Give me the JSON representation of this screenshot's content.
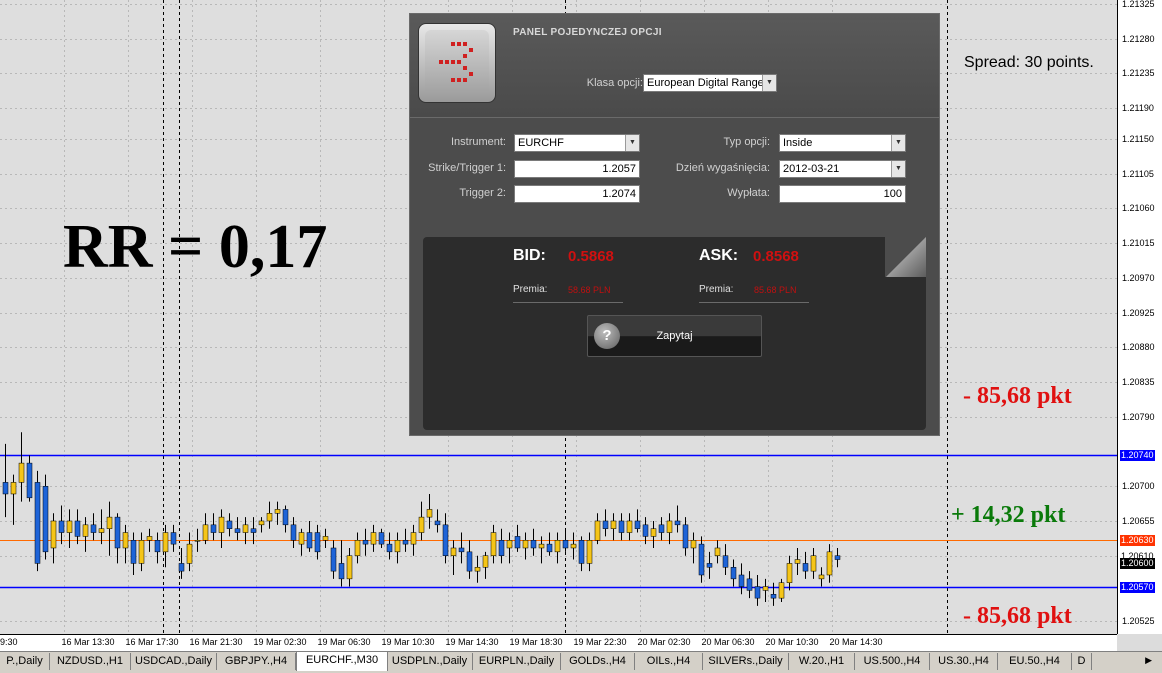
{
  "chart": {
    "symbol_tab": "EURCHF.,M30",
    "colors": {
      "background": "#dedede",
      "bull": "#f5c518",
      "bear": "#1e64d8",
      "wick": "#000000",
      "trigger_line": "#0000ff",
      "market_line": "#ff6a00"
    },
    "price_scale": {
      "max": 1.21325,
      "min": 1.20515
    },
    "price_labels": [
      "1.21325",
      "1.21280",
      "1.21235",
      "1.21190",
      "1.21150",
      "1.21105",
      "1.21060",
      "1.21015",
      "1.20970",
      "1.20925",
      "1.20880",
      "1.20835",
      "1.20790",
      "1.20700",
      "1.20655",
      "1.20610",
      "1.20525"
    ],
    "marked_prices": [
      {
        "value": "1.20740",
        "bg": "#0000ff",
        "fg": "#ffffff"
      },
      {
        "value": "1.20630",
        "bg": "#ff3300",
        "fg": "#ffffff"
      },
      {
        "value": "1.20610",
        "bg": "#ffffff",
        "fg": "#000000"
      },
      {
        "value": "1.20600",
        "bg": "#000000",
        "fg": "#ffffff"
      },
      {
        "value": "1.20570",
        "bg": "#0000ff",
        "fg": "#ffffff"
      }
    ],
    "time_labels": [
      "9:30",
      "16 Mar 13:30",
      "16 Mar 17:30",
      "16 Mar 21:30",
      "19 Mar 02:30",
      "19 Mar 06:30",
      "19 Mar 10:30",
      "19 Mar 14:30",
      "19 Mar 18:30",
      "19 Mar 22:30",
      "20 Mar 02:30",
      "20 Mar 06:30",
      "20 Mar 10:30",
      "20 Mar 14:30"
    ],
    "annotations": {
      "rr": "RR = 0,17",
      "spread": "Spread: 30 points.",
      "loss_top": "- 85,68 pkt",
      "gain": "+ 14,32 pkt",
      "loss_bottom": "- 85,68 pkt"
    }
  },
  "panel": {
    "title": "PANEL POJEDYNCZEJ OPCJI",
    "class_label": "Klasa opcji:",
    "class_value": "European Digital Range",
    "instrument_label": "Instrument:",
    "instrument_value": "EURCHF",
    "strike_label": "Strike/Trigger 1:",
    "strike_value": "1.2057",
    "trigger2_label": "Trigger 2:",
    "trigger2_value": "1.2074",
    "type_label": "Typ opcji:",
    "type_value": "Inside",
    "expiry_label": "Dzień wygaśnięcia:",
    "expiry_value": "2012-03-21",
    "payout_label": "Wypłata:",
    "payout_value": "100",
    "bid_label": "BID:",
    "bid_value": "0.5868",
    "ask_label": "ASK:",
    "ask_value": "0.8568",
    "premia_label": "Premia:",
    "bid_premia": "58.68 PLN",
    "ask_premia": "85.68 PLN",
    "button_label": "Zapytaj",
    "help_icon": "question-mark-icon"
  },
  "tabs": [
    "P.,Daily",
    "NZDUSD.,H1",
    "USDCAD.,Daily",
    "GBPJPY.,H4",
    "EURCHF.,M30",
    "USDPLN.,Daily",
    "EURPLN.,Daily",
    "GOLDs.,H4",
    "OILs.,H4",
    "SILVERs.,Daily",
    "W.20.,H1",
    "US.500.,H4",
    "US.30.,H4",
    "EU.50.,H4",
    "D"
  ],
  "active_tab": "EURCHF.,M30",
  "candles": [
    [
      1.20705,
      1.20755,
      1.2066,
      1.2069
    ],
    [
      1.2069,
      1.20715,
      1.2065,
      1.20705
    ],
    [
      1.20705,
      1.2077,
      1.2068,
      1.2073
    ],
    [
      1.2073,
      1.2074,
      1.2068,
      1.20685
    ],
    [
      1.20705,
      1.2072,
      1.2059,
      1.206
    ],
    [
      1.207,
      1.20715,
      1.20605,
      1.20615
    ],
    [
      1.2062,
      1.20665,
      1.206,
      1.20655
    ],
    [
      1.20655,
      1.20675,
      1.20625,
      1.2064
    ],
    [
      1.2064,
      1.2067,
      1.2062,
      1.20655
    ],
    [
      1.20655,
      1.2067,
      1.20625,
      1.20635
    ],
    [
      1.20635,
      1.2066,
      1.20615,
      1.2065
    ],
    [
      1.2065,
      1.20665,
      1.2063,
      1.2064
    ],
    [
      1.2064,
      1.2067,
      1.20625,
      1.20645
    ],
    [
      1.20645,
      1.2068,
      1.2061,
      1.2066
    ],
    [
      1.2066,
      1.20665,
      1.206,
      1.2062
    ],
    [
      1.2062,
      1.2065,
      1.206,
      1.2064
    ],
    [
      1.2063,
      1.2064,
      1.20585,
      1.206
    ],
    [
      1.206,
      1.2064,
      1.2059,
      1.2063
    ],
    [
      1.2063,
      1.20645,
      1.20615,
      1.20635
    ],
    [
      1.2063,
      1.2064,
      1.206,
      1.20615
    ],
    [
      1.20615,
      1.2065,
      1.20595,
      1.2064
    ],
    [
      1.2064,
      1.2065,
      1.20615,
      1.20625
    ],
    [
      1.206,
      1.2062,
      1.2058,
      1.2059
    ],
    [
      1.206,
      1.2064,
      1.2059,
      1.20625
    ],
    [
      1.2063,
      1.20645,
      1.20615,
      1.2063
    ],
    [
      1.2063,
      1.20665,
      1.20625,
      1.2065
    ],
    [
      1.2065,
      1.20665,
      1.2063,
      1.2064
    ],
    [
      1.2064,
      1.2067,
      1.2062,
      1.2066
    ],
    [
      1.20655,
      1.20665,
      1.20635,
      1.20645
    ],
    [
      1.20645,
      1.2066,
      1.2063,
      1.2064
    ],
    [
      1.2064,
      1.2066,
      1.20625,
      1.2065
    ],
    [
      1.20645,
      1.2066,
      1.20625,
      1.2064
    ],
    [
      1.2065,
      1.2066,
      1.2064,
      1.20655
    ],
    [
      1.20655,
      1.2068,
      1.20645,
      1.20665
    ],
    [
      1.20665,
      1.2068,
      1.2065,
      1.2067
    ],
    [
      1.2067,
      1.20675,
      1.2064,
      1.2065
    ],
    [
      1.2065,
      1.2066,
      1.2062,
      1.2063
    ],
    [
      1.20625,
      1.20645,
      1.2061,
      1.2064
    ],
    [
      1.2064,
      1.20655,
      1.20615,
      1.2062
    ],
    [
      1.2064,
      1.2065,
      1.20605,
      1.20615
    ],
    [
      1.2063,
      1.20645,
      1.2062,
      1.20635
    ],
    [
      1.2062,
      1.2063,
      1.2058,
      1.2059
    ],
    [
      1.206,
      1.2063,
      1.2057,
      1.2058
    ],
    [
      1.2058,
      1.2062,
      1.2057,
      1.2061
    ],
    [
      1.2061,
      1.2064,
      1.206,
      1.2063
    ],
    [
      1.2063,
      1.20645,
      1.2061,
      1.20625
    ],
    [
      1.20625,
      1.2065,
      1.20615,
      1.2064
    ],
    [
      1.2064,
      1.20645,
      1.2062,
      1.20625
    ],
    [
      1.20625,
      1.2064,
      1.20605,
      1.20615
    ],
    [
      1.20615,
      1.2064,
      1.206,
      1.2063
    ],
    [
      1.2063,
      1.20645,
      1.20615,
      1.20625
    ],
    [
      1.20625,
      1.2065,
      1.2061,
      1.2064
    ],
    [
      1.2064,
      1.2068,
      1.2063,
      1.2066
    ],
    [
      1.2066,
      1.2069,
      1.20645,
      1.2067
    ],
    [
      1.20655,
      1.2067,
      1.2064,
      1.2065
    ],
    [
      1.2065,
      1.20665,
      1.206,
      1.2061
    ],
    [
      1.2061,
      1.2063,
      1.20585,
      1.2062
    ],
    [
      1.2062,
      1.2064,
      1.206,
      1.20615
    ],
    [
      1.20615,
      1.2063,
      1.2058,
      1.2059
    ],
    [
      1.2059,
      1.2061,
      1.20575,
      1.20595
    ],
    [
      1.20595,
      1.20615,
      1.2058,
      1.2061
    ],
    [
      1.2061,
      1.2065,
      1.206,
      1.2064
    ],
    [
      1.2063,
      1.20645,
      1.206,
      1.2061
    ],
    [
      1.2062,
      1.2064,
      1.206,
      1.2063
    ],
    [
      1.20635,
      1.2065,
      1.20615,
      1.2062
    ],
    [
      1.2062,
      1.2064,
      1.20605,
      1.2063
    ],
    [
      1.2063,
      1.20645,
      1.2061,
      1.2062
    ],
    [
      1.2062,
      1.20635,
      1.206,
      1.20625
    ],
    [
      1.20625,
      1.2064,
      1.2061,
      1.20615
    ],
    [
      1.20615,
      1.2064,
      1.206,
      1.2063
    ],
    [
      1.2063,
      1.20645,
      1.20615,
      1.2062
    ],
    [
      1.2062,
      1.2064,
      1.20605,
      1.20625
    ],
    [
      1.2063,
      1.20635,
      1.2059,
      1.206
    ],
    [
      1.206,
      1.2064,
      1.2059,
      1.2063
    ],
    [
      1.2063,
      1.20665,
      1.20625,
      1.20655
    ],
    [
      1.20655,
      1.2067,
      1.20635,
      1.20645
    ],
    [
      1.20645,
      1.20665,
      1.2063,
      1.20655
    ],
    [
      1.20655,
      1.20665,
      1.2063,
      1.2064
    ],
    [
      1.2064,
      1.20665,
      1.2063,
      1.20655
    ],
    [
      1.20655,
      1.2067,
      1.2064,
      1.20645
    ],
    [
      1.2065,
      1.2066,
      1.20625,
      1.20635
    ],
    [
      1.20635,
      1.20655,
      1.2062,
      1.20645
    ],
    [
      1.2065,
      1.2066,
      1.2063,
      1.2064
    ],
    [
      1.2064,
      1.20665,
      1.20625,
      1.20655
    ],
    [
      1.20655,
      1.20675,
      1.2064,
      1.2065
    ],
    [
      1.2065,
      1.2066,
      1.2061,
      1.2062
    ],
    [
      1.2062,
      1.2064,
      1.206,
      1.2063
    ],
    [
      1.20625,
      1.20635,
      1.20575,
      1.20585
    ],
    [
      1.206,
      1.20615,
      1.2058,
      1.20595
    ],
    [
      1.2061,
      1.2063,
      1.206,
      1.2062
    ],
    [
      1.2061,
      1.20625,
      1.20585,
      1.20595
    ],
    [
      1.20595,
      1.20605,
      1.2057,
      1.2058
    ],
    [
      1.20585,
      1.206,
      1.2056,
      1.2057
    ],
    [
      1.2058,
      1.2059,
      1.20555,
      1.20565
    ],
    [
      1.2057,
      1.20585,
      1.20545,
      1.20555
    ],
    [
      1.20565,
      1.2058,
      1.2055,
      1.2057
    ],
    [
      1.2056,
      1.20575,
      1.20545,
      1.20555
    ],
    [
      1.20555,
      1.2058,
      1.2055,
      1.20575
    ],
    [
      1.20575,
      1.2061,
      1.20565,
      1.206
    ],
    [
      1.206,
      1.2062,
      1.20585,
      1.20605
    ],
    [
      1.206,
      1.20615,
      1.2058,
      1.2059
    ],
    [
      1.2059,
      1.2062,
      1.2058,
      1.2061
    ],
    [
      1.2058,
      1.20595,
      1.2057,
      1.20585
    ],
    [
      1.20585,
      1.20625,
      1.20575,
      1.20615
    ],
    [
      1.2061,
      1.2062,
      1.20595,
      1.20605
    ]
  ]
}
